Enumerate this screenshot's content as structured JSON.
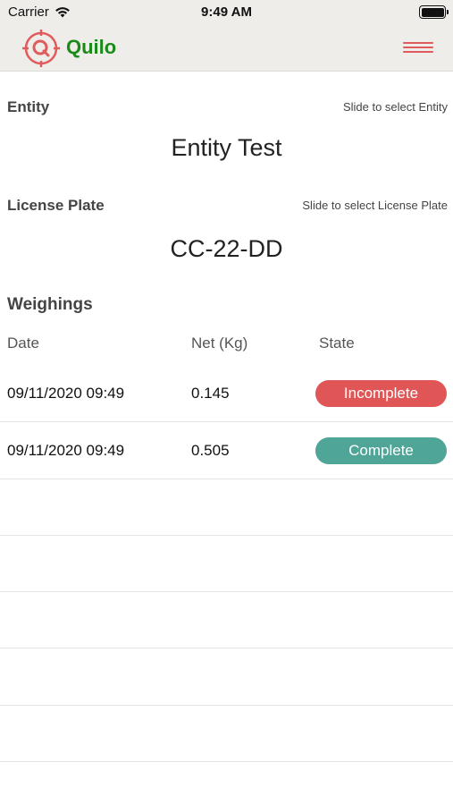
{
  "status_bar": {
    "carrier": "Carrier",
    "time": "9:49 AM",
    "battery_level_pct": 100
  },
  "header": {
    "brand": "Quilo",
    "logo_icon": "quilo-logo-crosshair",
    "menu_icon": "hamburger-menu-icon",
    "accent_color": "#e05b5b",
    "brand_color": "#1a8a1a"
  },
  "entity": {
    "label": "Entity",
    "hint": "Slide to select Entity",
    "value": "Entity Test"
  },
  "license_plate": {
    "label": "License Plate",
    "hint": "Slide to select License Plate",
    "value": "CC-22-DD"
  },
  "weighings": {
    "title": "Weighings",
    "columns": [
      "Date",
      "Net (Kg)",
      "State"
    ],
    "rows": [
      {
        "date": "09/11/2020 09:49",
        "net": "0.145",
        "state": "Incomplete",
        "state_color": "#e05656"
      },
      {
        "date": "09/11/2020 09:49",
        "net": "0.505",
        "state": "Complete",
        "state_color": "#4fa597"
      }
    ]
  }
}
